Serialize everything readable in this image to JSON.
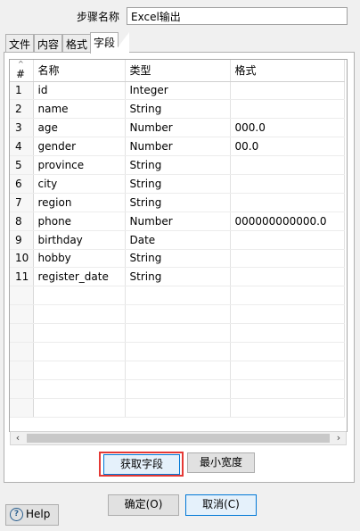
{
  "step": {
    "label": "步骤名称",
    "value": "Excel输出"
  },
  "tabs": [
    {
      "label": "文件"
    },
    {
      "label": "内容"
    },
    {
      "label": "格式"
    },
    {
      "label": "字段"
    }
  ],
  "table": {
    "headers": {
      "num": "#",
      "name": "名称",
      "type": "类型",
      "format": "格式"
    },
    "rows": [
      {
        "num": "1",
        "name": "id",
        "type": "Integer",
        "format": ""
      },
      {
        "num": "2",
        "name": "name",
        "type": "String",
        "format": ""
      },
      {
        "num": "3",
        "name": "age",
        "type": "Number",
        "format": "000.0"
      },
      {
        "num": "4",
        "name": "gender",
        "type": "Number",
        "format": "00.0"
      },
      {
        "num": "5",
        "name": "province",
        "type": "String",
        "format": ""
      },
      {
        "num": "6",
        "name": "city",
        "type": "String",
        "format": ""
      },
      {
        "num": "7",
        "name": "region",
        "type": "String",
        "format": ""
      },
      {
        "num": "8",
        "name": "phone",
        "type": "Number",
        "format": "000000000000.0"
      },
      {
        "num": "9",
        "name": "birthday",
        "type": "Date",
        "format": ""
      },
      {
        "num": "10",
        "name": "hobby",
        "type": "String",
        "format": ""
      },
      {
        "num": "11",
        "name": "register_date",
        "type": "String",
        "format": ""
      }
    ]
  },
  "buttons": {
    "get_fields": "获取字段",
    "min_width": "最小宽度",
    "ok": "确定(O)",
    "cancel": "取消(C)",
    "help": "Help"
  },
  "scroll": {
    "left_arrow": "‹",
    "right_arrow": "›"
  },
  "icons": {
    "sort": "sort-up-icon",
    "help": "help-icon"
  },
  "colors": {
    "highlight": "#e53935",
    "focus_border": "#0078d7"
  }
}
